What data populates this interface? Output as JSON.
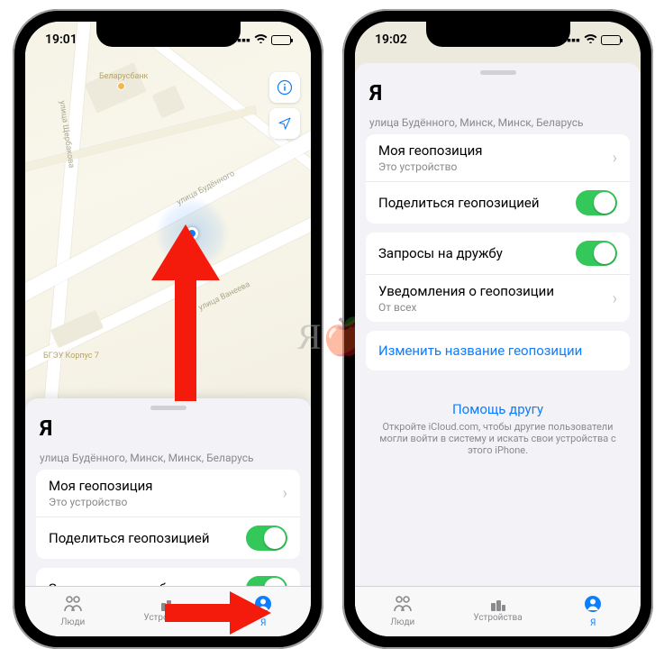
{
  "phoneA": {
    "time": "19:01",
    "map": {
      "bank_label": "Беларусбанк",
      "street_label": "улица Будённого",
      "street2_label": "улица Ванеева",
      "street3_label": "улица Щербакова",
      "bldg_label": "БГЭУ Корпус 7"
    },
    "sheet": {
      "title": "Я",
      "address": "улица Будённого, Минск, Минск, Беларусь",
      "rows": {
        "my_location": "Моя геопозиция",
        "my_location_sub": "Это устройство",
        "share": "Поделиться геопозицией",
        "friend_requests": "Запросы на дружбу"
      }
    },
    "tabs": {
      "people": "Люди",
      "devices": "Устройства",
      "me": "Я"
    }
  },
  "phoneB": {
    "time": "19:02",
    "sheet": {
      "title": "Я",
      "address": "улица Будённого, Минск, Минск, Беларусь",
      "rows": {
        "my_location": "Моя геопозиция",
        "my_location_sub": "Это устройство",
        "share": "Поделиться геопозицией",
        "friend_requests": "Запросы на дружбу",
        "notifications": "Уведомления о геопозиции",
        "notifications_sub": "От всех",
        "rename": "Изменить название геопозиции"
      },
      "help": {
        "title": "Помощь другу",
        "desc": "Откройте iCloud.com, чтобы другие пользователи могли войти в систему и искать свои устройства с этого iPhone."
      }
    },
    "tabs": {
      "people": "Люди",
      "devices": "Устройства",
      "me": "Я"
    }
  },
  "watermark": "Я лык"
}
